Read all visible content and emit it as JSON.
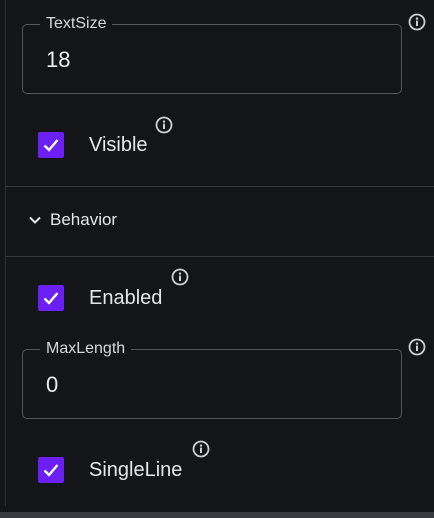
{
  "fields": {
    "text_size": {
      "label": "TextSize",
      "value": "18"
    },
    "max_length": {
      "label": "MaxLength",
      "value": "0"
    }
  },
  "checkboxes": {
    "visible": {
      "label": "Visible",
      "checked": true
    },
    "enabled": {
      "label": "Enabled",
      "checked": true
    },
    "single_line": {
      "label": "SingleLine",
      "checked": true
    }
  },
  "sections": {
    "behavior": {
      "label": "Behavior",
      "expanded": true,
      "icon": "chevron-down-icon"
    }
  },
  "colors": {
    "background": "#141519",
    "checkbox_fill": "#6b1ff2",
    "border": "#55575e",
    "text": "#e6e6e6"
  },
  "icons": {
    "info": "info-icon",
    "check": "check-icon"
  }
}
